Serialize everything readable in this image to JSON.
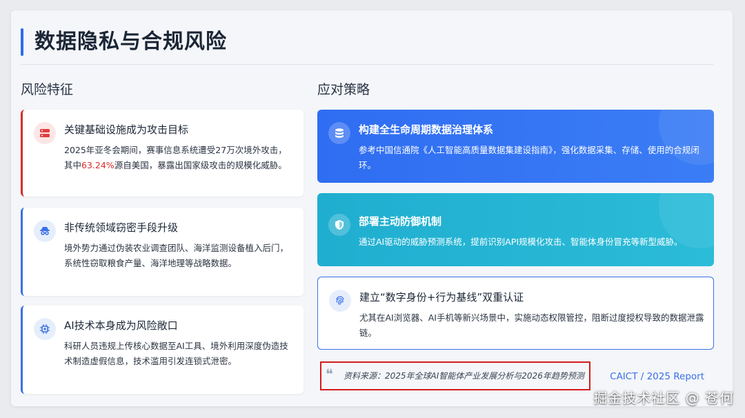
{
  "page": {
    "title": "数据隐私与合规风险",
    "watermark": "掘金技术社区 @ 苍何"
  },
  "risks": {
    "heading": "风险特征",
    "items": [
      {
        "icon": "server-icon",
        "title": "关键基础设施成为攻击目标",
        "body_before": "2025年亚冬会期间，赛事信息系统遭受27万次境外攻击，其中",
        "highlight": "63.24%",
        "body_after": "源自美国，暴露出国家级攻击的规模化威胁。"
      },
      {
        "icon": "spy-icon",
        "title": "非传统领域窃密手段升级",
        "body": "境外势力通过伪装农业调查团队、海洋监测设备植入后门，系统性窃取粮食产量、海洋地理等战略数据。"
      },
      {
        "icon": "chip-icon",
        "title": "AI技术本身成为风险敞口",
        "body": "科研人员违规上传核心数据至AI工具、境外利用深度伪造技术制造虚假信息，技术滥用引发连锁式泄密。"
      }
    ]
  },
  "strategies": {
    "heading": "应对策略",
    "items": [
      {
        "icon": "database-icon",
        "title": "构建全生命周期数据治理体系",
        "body": "参考中国信通院《人工智能高质量数据集建设指南》，强化数据采集、存储、使用的合规闭环。"
      },
      {
        "icon": "shield-icon",
        "title": "部署主动防御机制",
        "body": "通过AI驱动的威胁预测系统，提前识别API规模化攻击、智能体身份冒充等新型威胁。"
      },
      {
        "icon": "fingerprint-icon",
        "title": "建立“数字身份+行为基线”双重认证",
        "body": "尤其在AI浏览器、AI手机等新兴场景中，实施动态权限管控，阻断过度授权导致的数据泄露链。"
      }
    ]
  },
  "source": {
    "quote_icon": "quote-icon",
    "text": "资料来源：2025年全球AI智能体产业发展分析与2026年趋势预测",
    "reference": "CAICT / 2025 Report"
  },
  "colors": {
    "accent_blue": "#2f6df2",
    "accent_teal": "#20aed0",
    "alert_red": "#d92b2b"
  }
}
